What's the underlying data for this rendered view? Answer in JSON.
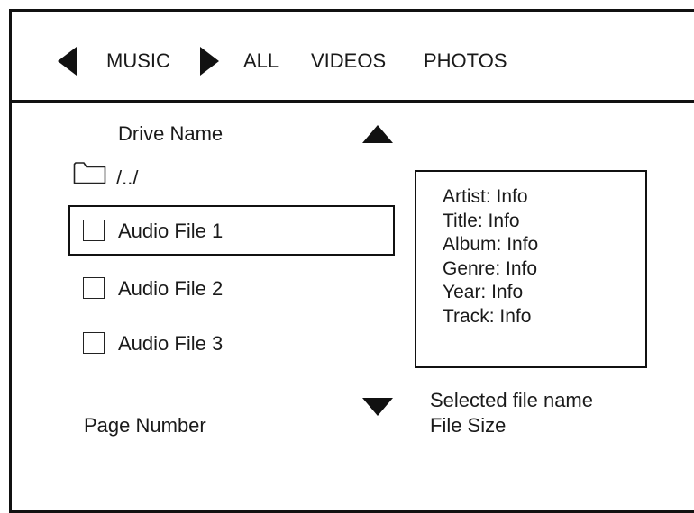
{
  "header": {
    "tabs": [
      {
        "label": "MUSIC"
      },
      {
        "label": "ALL"
      },
      {
        "label": "VIDEOS"
      },
      {
        "label": "PHOTOS"
      }
    ]
  },
  "browser": {
    "drive_name": "Drive Name",
    "parent_dir": "/../",
    "files": [
      {
        "label": "Audio File 1",
        "selected": true
      },
      {
        "label": "Audio File 2",
        "selected": false
      },
      {
        "label": "Audio File 3",
        "selected": false
      }
    ],
    "page_number": "Page Number"
  },
  "info_panel": {
    "artist": "Artist: Info",
    "title": "Title: Info",
    "album": "Album: Info",
    "genre": "Genre: Info",
    "year": "Year: Info",
    "track": "Track: Info"
  },
  "selection": {
    "file_name": "Selected file name",
    "file_size": "File Size"
  },
  "icons": {
    "prev": "triangle-left-icon",
    "next": "triangle-right-icon",
    "scroll_up": "triangle-up-icon",
    "scroll_down": "triangle-down-icon",
    "folder": "folder-icon",
    "checkbox": "checkbox-icon"
  },
  "colors": {
    "line": "#111111",
    "background": "#ffffff",
    "text": "#1a1a1a"
  }
}
